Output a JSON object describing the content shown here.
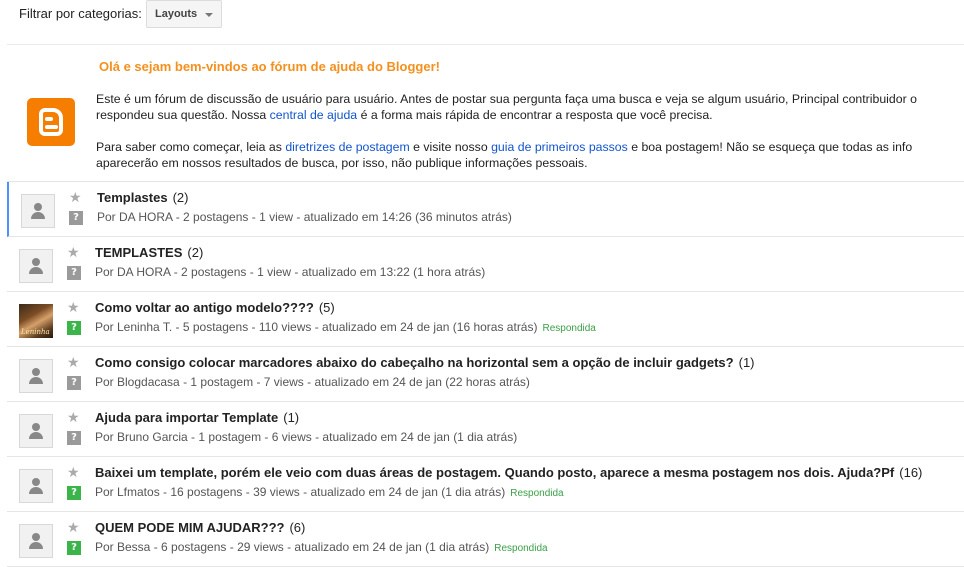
{
  "filter": {
    "label": "Filtrar por categorias:",
    "selected": "Layouts"
  },
  "welcome": {
    "title": "Olá e sejam bem-vindos ao fórum de ajuda do Blogger!",
    "logo_icon": "blogger-logo-icon",
    "p1_line1": "Este é um fórum de discussão de usuário para usuário. Antes de postar sua pergunta faça uma busca e veja se algum usuário, Principal contribuidor o",
    "p1_line2_pre": "respondeu sua questão. Nossa ",
    "p1_link": "central de ajuda",
    "p1_line2_post": " é a forma mais rápida de encontrar a resposta que você precisa.",
    "p2_pre": "Para saber como começar, leia as ",
    "p2_link1": "diretrizes de postagem",
    "p2_mid": " e visite nosso ",
    "p2_link2": "guia de primeiros passos",
    "p2_post": " e boa postagem! Não se esqueça que todas as info",
    "p2_line2": "aparecerão em nossos resultados de busca, por isso, não publique informações pessoais."
  },
  "colors": {
    "accent_orange": "#f4901e",
    "link_blue": "#1155cc",
    "answered_green": "#3bb54a",
    "selected_bar": "#4d90fe"
  },
  "topics": [
    {
      "title": "Templastes",
      "count": "(2)",
      "author": "Por DA HORA",
      "stats": " - 2 postagens - 1 view - atualizado em 14:26 (36 minutos atrás)",
      "badge": "",
      "answered": false,
      "photo": false,
      "selected": true
    },
    {
      "title": "TEMPLASTES",
      "count": "(2)",
      "author": "Por DA HORA",
      "stats": " - 2 postagens - 1 view - atualizado em 13:22 (1 hora atrás)",
      "badge": "",
      "answered": false,
      "photo": false,
      "selected": false
    },
    {
      "title": "Como voltar ao antigo modelo????",
      "count": "(5)",
      "author": "Por Leninha T.",
      "stats": "  - 5 postagens - 110 views - atualizado em 24 de jan (16 horas atrás)",
      "badge": "Respondida",
      "answered": true,
      "photo": true,
      "selected": false
    },
    {
      "title": "Como consigo colocar marcadores abaixo do cabeçalho na horizontal sem a opção de incluir gadgets?",
      "count": "(1)",
      "author": "Por Blogdacasa",
      "stats": " - 1 postagem - 7 views - atualizado em 24 de jan (22 horas atrás)",
      "badge": "",
      "answered": false,
      "photo": false,
      "selected": false
    },
    {
      "title": "Ajuda para importar Template",
      "count": "(1)",
      "author": "Por Bruno Garcia",
      "stats": " - 1 postagem - 6 views - atualizado em 24 de jan (1 dia atrás)",
      "badge": "",
      "answered": false,
      "photo": false,
      "selected": false
    },
    {
      "title": "Baixei um template, porém ele veio com duas áreas de postagem. Quando posto, aparece a mesma postagem nos dois. Ajuda?Pf",
      "count": "(16)",
      "author": "Por Lfmatos",
      "stats": "  - 16 postagens - 39 views - atualizado em 24 de jan (1 dia atrás)",
      "badge": "Respondida",
      "answered": true,
      "photo": false,
      "selected": false
    },
    {
      "title": "QUEM PODE MIM AJUDAR???",
      "count": "(6)",
      "author": "Por Bessa",
      "stats": " - 6 postagens - 29 views - atualizado em 24 de jan (1 dia atrás)",
      "badge": "Respondida",
      "answered": true,
      "photo": false,
      "selected": false
    }
  ],
  "avatar_photo_caption": "Leninha"
}
